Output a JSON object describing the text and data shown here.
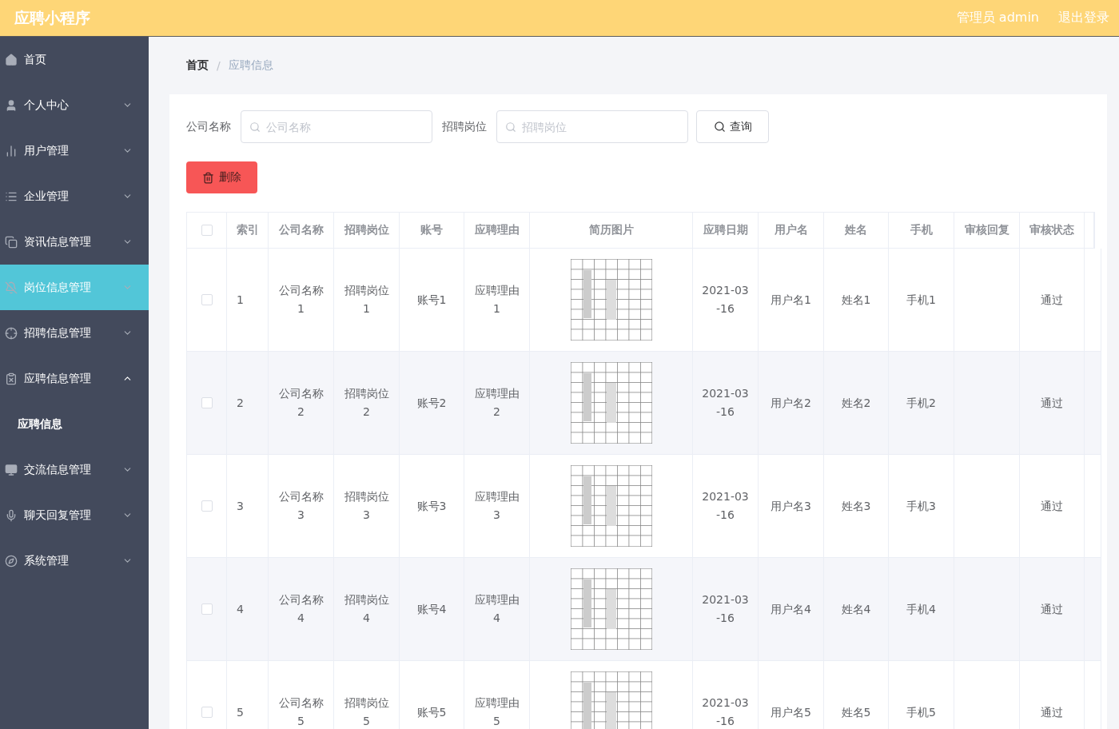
{
  "header": {
    "title": "应聘小程序",
    "user": "管理员 admin",
    "logout": "退出登录"
  },
  "sidebar": {
    "items": [
      {
        "label": "首页",
        "selected": false
      },
      {
        "label": "个人中心",
        "expanded": false,
        "selected": false
      },
      {
        "label": "用户管理",
        "expanded": false,
        "selected": false
      },
      {
        "label": "企业管理",
        "expanded": false,
        "selected": false
      },
      {
        "label": "资讯信息管理",
        "expanded": false,
        "selected": false
      },
      {
        "label": "岗位信息管理",
        "expanded": false,
        "selected": true
      },
      {
        "label": "招聘信息管理",
        "expanded": false,
        "selected": false
      },
      {
        "label": "应聘信息管理",
        "expanded": true,
        "selected": false,
        "children": [
          {
            "label": "应聘信息",
            "selected": true
          }
        ]
      },
      {
        "label": "交流信息管理",
        "expanded": false,
        "selected": false
      },
      {
        "label": "聊天回复管理",
        "expanded": false,
        "selected": false
      },
      {
        "label": "系统管理",
        "expanded": false,
        "selected": false
      }
    ]
  },
  "breadcrumb": [
    {
      "label": "首页"
    },
    {
      "label": "应聘信息"
    }
  ],
  "breadcrumb_separator": "/",
  "search": {
    "fields": [
      {
        "label": "公司名称",
        "placeholder": "公司名称"
      },
      {
        "label": "招聘岗位",
        "placeholder": "招聘岗位"
      }
    ],
    "query_button": "查询"
  },
  "delete_button": "删除",
  "table": {
    "select_all_checked": false,
    "columns": [
      "索引",
      "公司名称",
      "招聘岗位",
      "账号",
      "应聘理由",
      "简历图片",
      "应聘日期",
      "用户名",
      "姓名",
      "手机",
      "审核回复",
      "审核状态"
    ],
    "rows": [
      {
        "checked": false,
        "cells": [
          "1",
          "公司名称1",
          "招聘岗位1",
          "账号1",
          "应聘理由1",
          {
            "kind": "picture"
          },
          "2021-03-16",
          "用户名1",
          "姓名1",
          "手机1",
          "",
          "通过"
        ]
      },
      {
        "checked": false,
        "cells": [
          "2",
          "公司名称2",
          "招聘岗位2",
          "账号2",
          "应聘理由2",
          {
            "kind": "picture"
          },
          "2021-03-16",
          "用户名2",
          "姓名2",
          "手机2",
          "",
          "通过"
        ]
      },
      {
        "checked": false,
        "cells": [
          "3",
          "公司名称3",
          "招聘岗位3",
          "账号3",
          "应聘理由3",
          {
            "kind": "picture"
          },
          "2021-03-16",
          "用户名3",
          "姓名3",
          "手机3",
          "",
          "通过"
        ]
      },
      {
        "checked": false,
        "cells": [
          "4",
          "公司名称4",
          "招聘岗位4",
          "账号4",
          "应聘理由4",
          {
            "kind": "picture"
          },
          "2021-03-16",
          "用户名4",
          "姓名4",
          "手机4",
          "",
          "通过"
        ]
      },
      {
        "checked": false,
        "cells": [
          "5",
          "公司名称5",
          "招聘岗位5",
          "账号5",
          "应聘理由5",
          {
            "kind": "picture"
          },
          "2021-03-16",
          "用户名5",
          "姓名5",
          "手机5",
          "",
          "通过"
        ]
      }
    ]
  }
}
